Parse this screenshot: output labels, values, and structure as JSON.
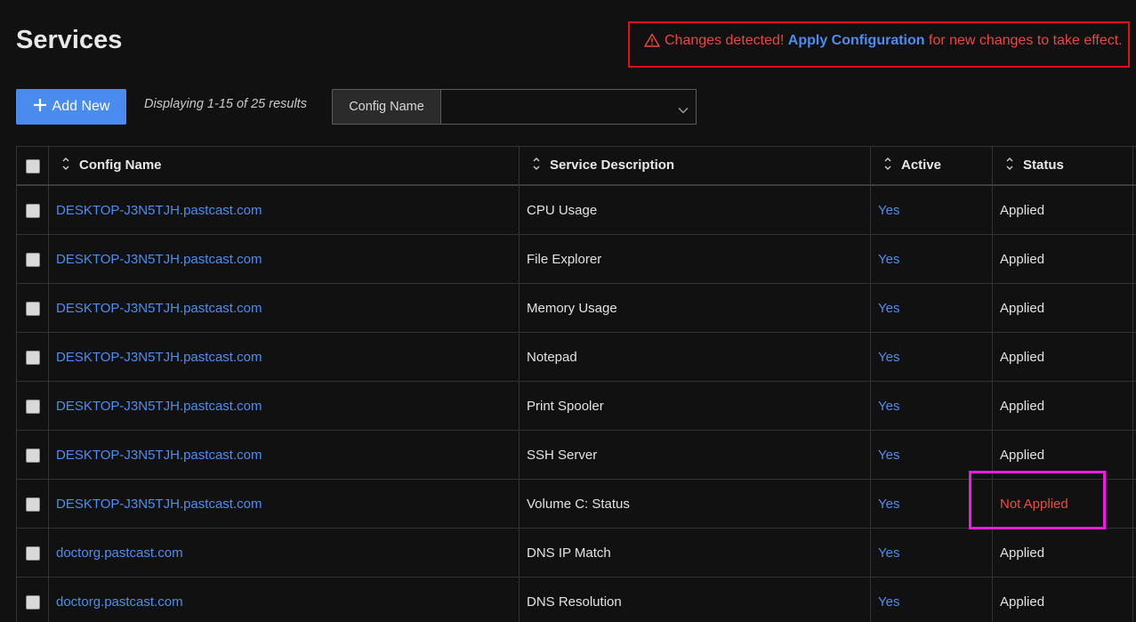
{
  "page": {
    "title": "Services"
  },
  "alert": {
    "prefix": "Changes detected!",
    "link_text": "Apply Configuration",
    "suffix": "for new changes to take effect.",
    "icon": "warning-icon",
    "color": "#e9473f"
  },
  "toolbar": {
    "add_label": "Add New",
    "results_text": "Displaying 1-15 of 25 results",
    "filter_label": "Config Name",
    "filter_value": ""
  },
  "table": {
    "columns": [
      "Config Name",
      "Service Description",
      "Active",
      "Status"
    ],
    "rows": [
      {
        "config": "DESKTOP-J3N5TJH.pastcast.com",
        "service": "CPU Usage",
        "active": "Yes",
        "status": "Applied"
      },
      {
        "config": "DESKTOP-J3N5TJH.pastcast.com",
        "service": "File Explorer",
        "active": "Yes",
        "status": "Applied"
      },
      {
        "config": "DESKTOP-J3N5TJH.pastcast.com",
        "service": "Memory Usage",
        "active": "Yes",
        "status": "Applied"
      },
      {
        "config": "DESKTOP-J3N5TJH.pastcast.com",
        "service": "Notepad",
        "active": "Yes",
        "status": "Applied"
      },
      {
        "config": "DESKTOP-J3N5TJH.pastcast.com",
        "service": "Print Spooler",
        "active": "Yes",
        "status": "Applied"
      },
      {
        "config": "DESKTOP-J3N5TJH.pastcast.com",
        "service": "SSH Server",
        "active": "Yes",
        "status": "Applied"
      },
      {
        "config": "DESKTOP-J3N5TJH.pastcast.com",
        "service": "Volume C: Status",
        "active": "Yes",
        "status": "Not Applied"
      },
      {
        "config": "doctorg.pastcast.com",
        "service": "DNS IP Match",
        "active": "Yes",
        "status": "Applied"
      },
      {
        "config": "doctorg.pastcast.com",
        "service": "DNS Resolution",
        "active": "Yes",
        "status": "Applied"
      }
    ]
  },
  "colors": {
    "accent": "#4a8bf0",
    "link": "#4d8df0",
    "error": "#ea4c44",
    "alert_border": "#e0101a",
    "highlight_border": "#ef19e6",
    "background": "#111111"
  }
}
